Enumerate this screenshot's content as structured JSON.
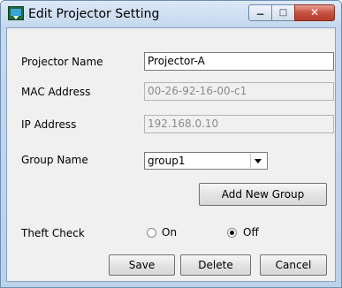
{
  "window": {
    "title": "Edit Projector Setting",
    "minimize_glyph": "−",
    "maximize_glyph": "□",
    "close_glyph": "✕"
  },
  "fields": {
    "projector_name": {
      "label": "Projector Name",
      "value": "Projector-A"
    },
    "mac_address": {
      "label": "MAC Address",
      "value": "00-26-92-16-00-c1"
    },
    "ip_address": {
      "label": "IP Address",
      "value": "192.168.0.10"
    },
    "group_name": {
      "label": "Group Name",
      "value": "group1"
    }
  },
  "add_group_button": "Add New Group",
  "theft_check": {
    "label": "Theft Check",
    "on_label": "On",
    "off_label": "Off",
    "selected": "Off"
  },
  "buttons": {
    "save": "Save",
    "delete": "Delete",
    "cancel": "Cancel"
  },
  "colors": {
    "close_button": "#c75040",
    "title_bar": "#c5d8ee",
    "dialog_bg": "#f0f0f0"
  }
}
